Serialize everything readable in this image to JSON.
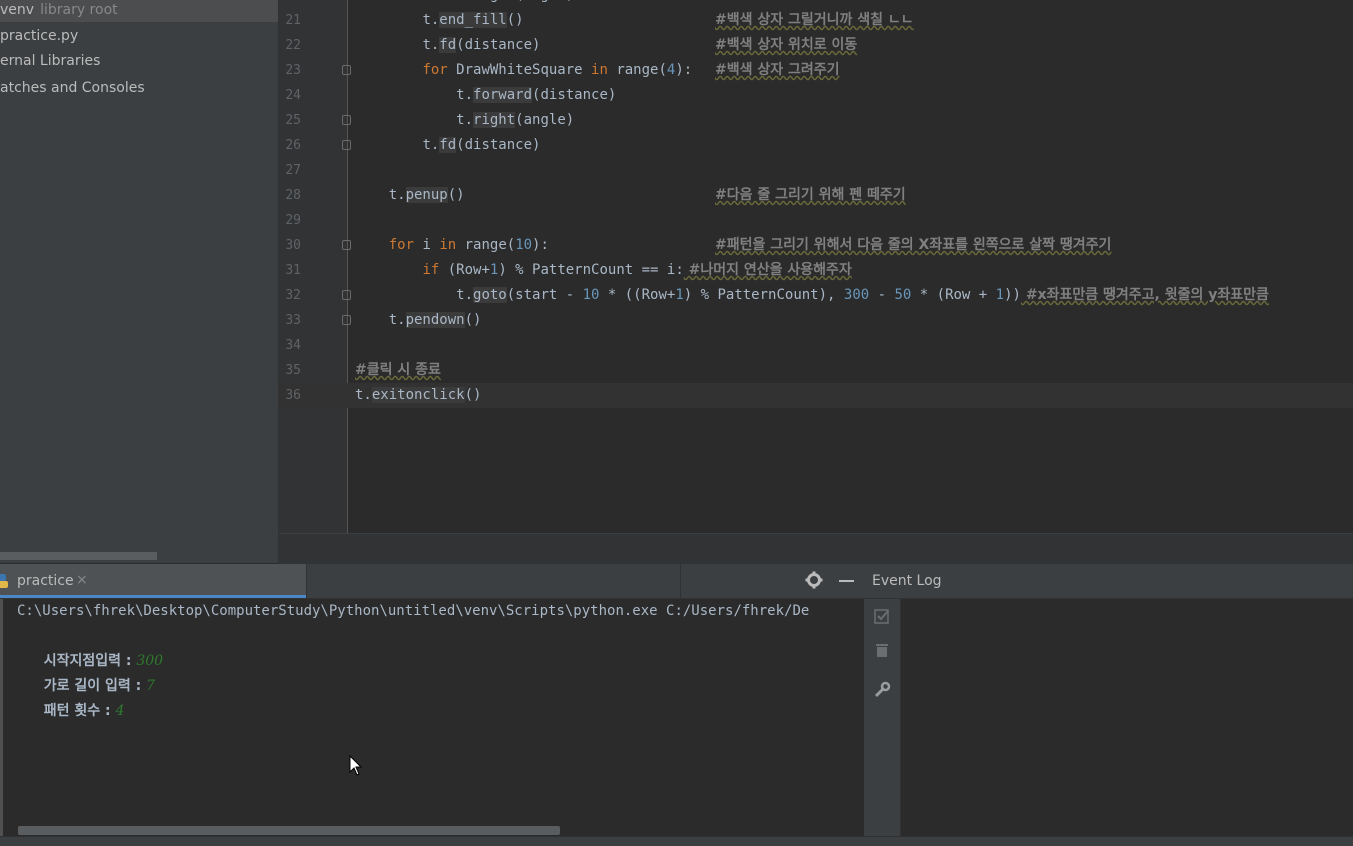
{
  "project_tree": {
    "items": [
      {
        "label": "venv",
        "hint": "library root"
      },
      {
        "label": "practice.py"
      },
      {
        "label": "ernal Libraries"
      },
      {
        "label": "atches and Consoles"
      }
    ]
  },
  "editor": {
    "top_partial": "t.right(angle)",
    "lines": [
      {
        "num": "21",
        "indent": "        ",
        "code": "t.end_fill()",
        "comment": "#백색 상자 그릴거니까 색칠 ㄴㄴ"
      },
      {
        "num": "22",
        "indent": "        ",
        "code": "t.fd(distance)",
        "comment": "#백색 상자 위치로 이동"
      },
      {
        "num": "23",
        "indent": "        ",
        "code": "for DrawWhiteSquare in range(4):",
        "comment": "#백색 상자 그려주기"
      },
      {
        "num": "24",
        "indent": "            ",
        "code": "t.forward(distance)",
        "comment": ""
      },
      {
        "num": "25",
        "indent": "            ",
        "code": "t.right(angle)",
        "comment": ""
      },
      {
        "num": "26",
        "indent": "        ",
        "code": "t.fd(distance)",
        "comment": ""
      },
      {
        "num": "27",
        "indent": "",
        "code": "",
        "comment": ""
      },
      {
        "num": "28",
        "indent": "    ",
        "code": "t.penup()",
        "comment": "#다음 줄 그리기 위해 펜 떼주기"
      },
      {
        "num": "29",
        "indent": "",
        "code": "",
        "comment": ""
      },
      {
        "num": "30",
        "indent": "    ",
        "code": "for i in range(10):",
        "comment": "#패턴을 그리기 위해서 다음 줄의 X좌표를 왼쪽으로 살짝 땡겨주기"
      },
      {
        "num": "31",
        "indent": "        ",
        "code": "if (Row+1) % PatternCount == i:",
        "comment": " #나머지 연산을 사용해주자"
      },
      {
        "num": "32",
        "indent": "            ",
        "code": "t.goto(start - 10 * ((Row+1) % PatternCount), 300 - 50 * (Row + 1))",
        "comment": " #x좌표만큼 땡겨주고, 윗줄의 y좌표만큼"
      },
      {
        "num": "33",
        "indent": "    ",
        "code": "t.pendown()",
        "comment": ""
      },
      {
        "num": "34",
        "indent": "",
        "code": "",
        "comment": ""
      },
      {
        "num": "35",
        "indent": "",
        "code": "",
        "comment": "#클릭 시 종료"
      },
      {
        "num": "36",
        "indent": "",
        "code": "t.exitonclick()",
        "comment": ""
      }
    ]
  },
  "run_panel": {
    "tab_label": "practice",
    "close_glyph": "×",
    "command": "C:\\Users\\fhrek\\Desktop\\ComputerStudy\\Python\\untitled\\venv\\Scripts\\python.exe C:/Users/fhrek/De",
    "prompts": [
      {
        "label": "시작지점입력 : ",
        "value": "300"
      },
      {
        "label": "가로 길이 입력 : ",
        "value": "7"
      },
      {
        "label": "패턴 횟수 : ",
        "value": "4"
      }
    ]
  },
  "event_log": {
    "title": "Event Log"
  },
  "colors": {
    "keyword": "#cc7832",
    "number": "#6897bb",
    "comment": "#808080",
    "input": "#2d7a2d",
    "accent": "#4a88c7"
  }
}
